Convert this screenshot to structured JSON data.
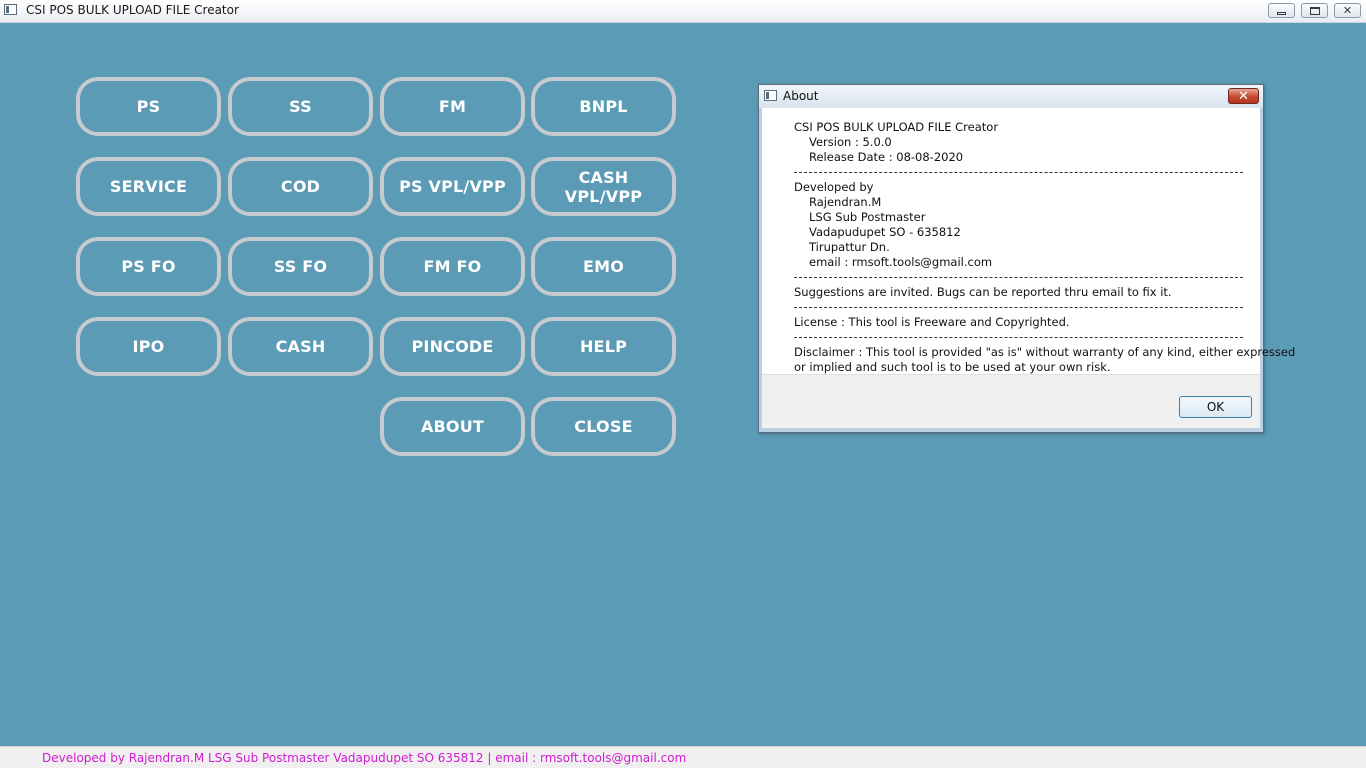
{
  "window": {
    "title": "CSI POS BULK UPLOAD FILE Creator",
    "minimize_icon": "minimize-icon",
    "maximize_icon": "restore-icon",
    "close_symbol": "✕"
  },
  "buttons": [
    {
      "label": "PS"
    },
    {
      "label": "SS"
    },
    {
      "label": "FM"
    },
    {
      "label": "BNPL"
    },
    {
      "label": "SERVICE"
    },
    {
      "label": "COD"
    },
    {
      "label": "PS VPL/VPP"
    },
    {
      "label": "CASH\nVPL/VPP"
    },
    {
      "label": "PS FO"
    },
    {
      "label": "SS FO"
    },
    {
      "label": "FM FO"
    },
    {
      "label": "EMO"
    },
    {
      "label": "IPO"
    },
    {
      "label": "CASH"
    },
    {
      "label": "PINCODE"
    },
    {
      "label": "HELP"
    },
    {
      "label": "ABOUT"
    },
    {
      "label": "CLOSE"
    }
  ],
  "about_dialog": {
    "title": "About",
    "close_symbol": "✕",
    "app_name": "CSI POS BULK UPLOAD FILE Creator",
    "version": "Version : 5.0.0",
    "release_date": "Release Date : 08-08-2020",
    "developed_by": "Developed by",
    "developer_name": "Rajendran.M",
    "developer_role": "LSG Sub Postmaster",
    "developer_office": "Vadapudupet SO - 635812",
    "developer_division": "Tirupattur Dn.",
    "developer_email": "email : rmsoft.tools@gmail.com",
    "suggestions": "Suggestions are invited. Bugs can be reported thru email to fix it.",
    "license": "License : This tool is Freeware and Copyrighted.",
    "disclaimer_line1": "Disclaimer : This tool is provided \"as is\" without warranty of any kind, either expressed",
    "disclaimer_line2": "or implied and such tool is to be used at your own risk.",
    "ok_label": "OK"
  },
  "statusbar": {
    "text": "Developed by Rajendran.M LSG Sub Postmaster Vadapudupet SO 635812 | email : rmsoft.tools@gmail.com",
    "color": "#d21bd2"
  },
  "colors": {
    "background": "#5b9bb5",
    "button_border": "#c5cbcf",
    "button_text": "#ffffff"
  }
}
